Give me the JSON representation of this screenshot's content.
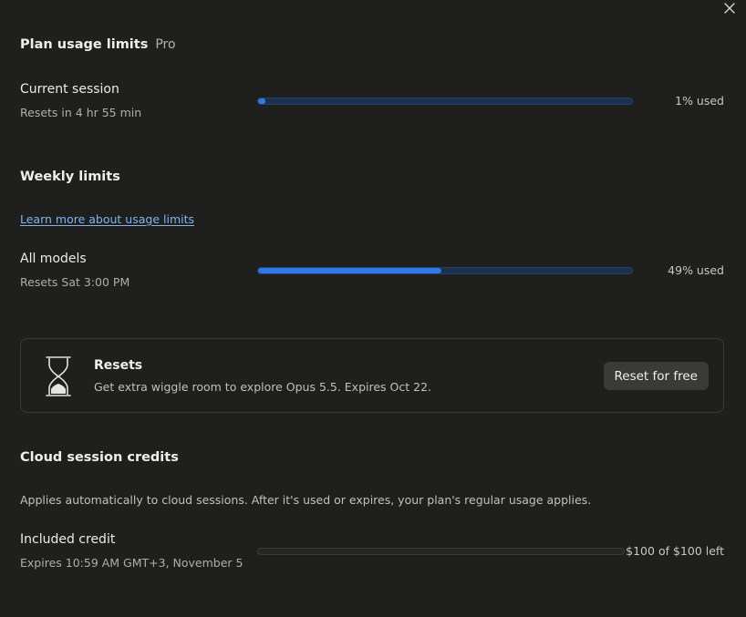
{
  "header": {
    "title": "Plan usage limits",
    "plan": "Pro"
  },
  "current_session": {
    "title": "Current session",
    "subtitle": "Resets in 4 hr 55 min",
    "percent_used": 1,
    "used_label": "1% used"
  },
  "weekly": {
    "title": "Weekly limits",
    "learn_more": "Learn more about usage limits",
    "all_models": {
      "title": "All models",
      "subtitle": "Resets Sat 3:00 PM",
      "percent_used": 49,
      "used_label": "49% used"
    }
  },
  "resets_card": {
    "icon": "hourglass-icon",
    "title": "Resets",
    "description": "Get extra wiggle room to explore Opus 5.5. Expires Oct 22.",
    "button_label": "Reset for free"
  },
  "cloud": {
    "title": "Cloud session credits",
    "description": "Applies automatically to cloud sessions. After it's used or expires, your plan's regular usage applies.",
    "included_credit": {
      "title": "Included credit",
      "subtitle": "Expires 10:59 AM GMT+3, November 5",
      "remaining_fraction": 1.0,
      "left_label": "$100 of $100 left"
    }
  },
  "colors": {
    "background": "#1f1f1e",
    "accent": "#2f7ae5",
    "link": "#7fb4ef"
  },
  "icons": {
    "close": "close-icon"
  }
}
